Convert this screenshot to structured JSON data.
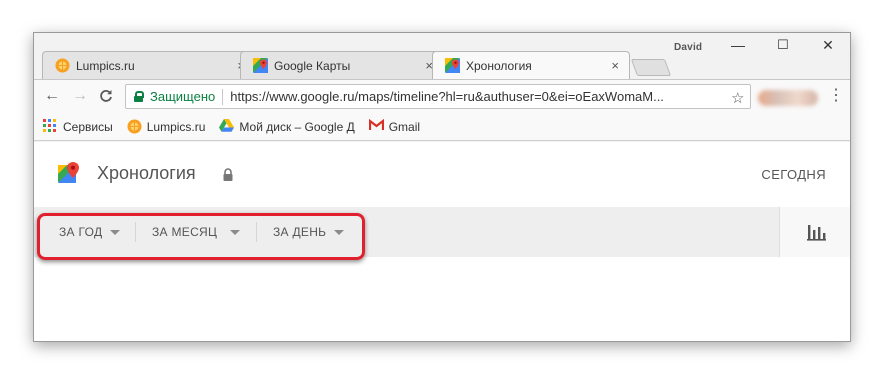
{
  "browser": {
    "user_name": "David",
    "window_controls": {
      "minimize": "—",
      "maximize": "☐",
      "close": "✕"
    },
    "tabs": [
      {
        "title": "Lumpics.ru",
        "close": "×",
        "favicon": "orange-circle-icon"
      },
      {
        "title": "Google Карты",
        "close": "×",
        "favicon": "google-maps-icon"
      },
      {
        "title": "Хронология",
        "close": "×",
        "favicon": "google-maps-icon",
        "active": true
      }
    ],
    "nav": {
      "back": "←",
      "forward": "→",
      "reload": "C"
    },
    "omnibox": {
      "secure_label": "Защищено",
      "url": "https://www.google.ru/maps/timeline?hl=ru&authuser=0&ei=oEaxWomaM..."
    },
    "star": "☆",
    "menu": "⋮",
    "bookmarks": [
      {
        "label": "Сервисы",
        "icon": "apps-grid-icon"
      },
      {
        "label": "Lumpics.ru",
        "icon": "orange-circle-icon"
      },
      {
        "label": "Мой диск – Google Д",
        "icon": "google-drive-icon"
      },
      {
        "label": "Gmail",
        "icon": "gmail-icon"
      }
    ]
  },
  "page": {
    "title": "Хронология",
    "today_button": "СЕГОДНЯ",
    "filters": [
      {
        "label": "ЗА ГОД"
      },
      {
        "label": "ЗА МЕСЯЦ"
      },
      {
        "label": "ЗА ДЕНЬ"
      }
    ],
    "accent_highlight": "#e0202e"
  }
}
